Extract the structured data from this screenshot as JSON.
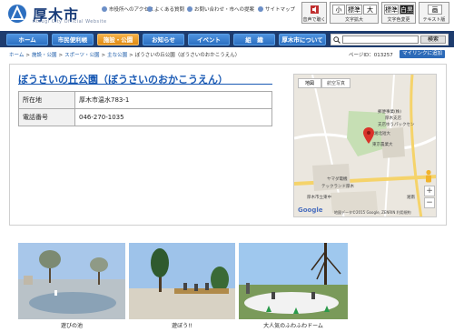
{
  "header": {
    "logo_text": "厚木市",
    "logo_sub": "Atsugi City Official Website",
    "top_links": [
      "市役所へのアクセス",
      "よくある質問",
      "お問い合わせ・市への提案",
      "サイトマップ"
    ],
    "voice_label": "音声で聴く",
    "text_size": {
      "small": "小",
      "standard": "標準",
      "large": "大",
      "caption": "文字拡大"
    },
    "color": {
      "standard": "標準",
      "white": "白黒",
      "caption": "文字色変更"
    },
    "text_only": {
      "label": "画",
      "caption": "テキスト版"
    }
  },
  "nav": {
    "items": [
      "ホーム",
      "市民便利帳",
      "施設・公園",
      "お知らせ",
      "イベント",
      "組　織",
      "厚木市について"
    ],
    "search_button": "検索",
    "search_placeholder": ""
  },
  "breadcrumb": {
    "items": [
      "ホーム",
      "施設・公園",
      "スポーツ・公園",
      "主な公園",
      "ぼうさいの丘公園（ぼうさいのおかこうえん）"
    ],
    "separator": ">"
  },
  "page_id": "ページID：013257",
  "mylink_label": "マイリンクに追加",
  "page_title": "ぼうさいの丘公園（ぼうさいのおかこうえん）",
  "info": [
    {
      "label": "所在地",
      "value": "厚木市温水783-1"
    },
    {
      "label": "電話番号",
      "value": "046-270-1035"
    }
  ],
  "map": {
    "tab_map": "地図",
    "tab_satellite": "航空写真",
    "labels": [
      "郵便事業(株)",
      "厚木支店",
      "支店ゆうパックセン",
      "湘北短大",
      "東京農業大",
      "ヤマダ電機",
      "テックランド厚木",
      "厚木市立東中",
      "湘南"
    ],
    "google": "Google",
    "copyright": "地図データ©2015 Google, ZENRIN  利用規約"
  },
  "photos": [
    {
      "caption": "遊びの池"
    },
    {
      "caption": "遊ぼう!!"
    },
    {
      "caption": "大人気のふわふわドーム"
    }
  ],
  "colors": {
    "nav_bg": "#1e3c6e",
    "nav_active": "#e08b12",
    "title_blue": "#1a5ab4"
  }
}
